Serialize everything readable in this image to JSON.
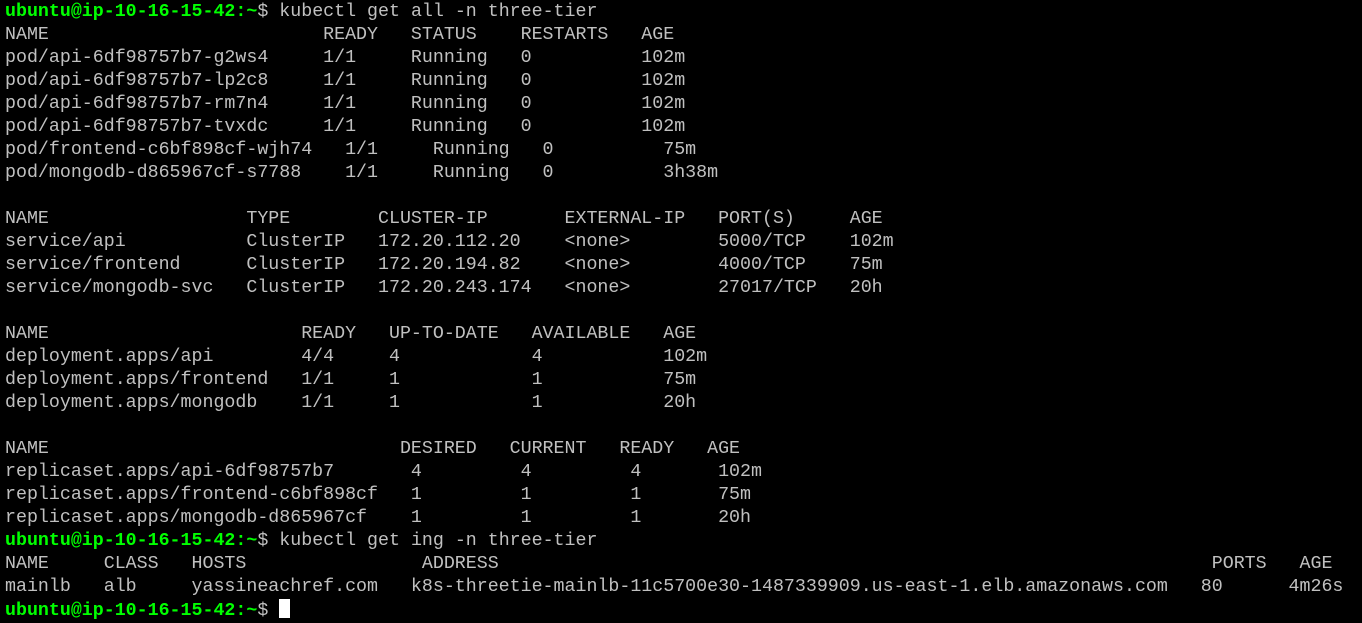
{
  "window": {
    "prompt_user": "ubuntu@ip-10-16-15-42:",
    "prompt_path": "~",
    "prompt_symbol": "$ ",
    "text_color": "#c0c0c0",
    "prompt_color": "#00ff00",
    "background": "#000000"
  },
  "lines": [
    {
      "type": "prompt",
      "command": "kubectl get all -n three-tier"
    },
    {
      "type": "output",
      "text": "NAME                         READY   STATUS    RESTARTS   AGE"
    },
    {
      "type": "output",
      "text": "pod/api-6df98757b7-g2ws4     1/1     Running   0          102m"
    },
    {
      "type": "output",
      "text": "pod/api-6df98757b7-lp2c8     1/1     Running   0          102m"
    },
    {
      "type": "output",
      "text": "pod/api-6df98757b7-rm7n4     1/1     Running   0          102m"
    },
    {
      "type": "output",
      "text": "pod/api-6df98757b7-tvxdc     1/1     Running   0          102m"
    },
    {
      "type": "output",
      "text": "pod/frontend-c6bf898cf-wjh74   1/1     Running   0          75m"
    },
    {
      "type": "output",
      "text": "pod/mongodb-d865967cf-s7788    1/1     Running   0          3h38m"
    },
    {
      "type": "output",
      "text": ""
    },
    {
      "type": "output",
      "text": "NAME                  TYPE        CLUSTER-IP       EXTERNAL-IP   PORT(S)     AGE"
    },
    {
      "type": "output",
      "text": "service/api           ClusterIP   172.20.112.20    <none>        5000/TCP    102m"
    },
    {
      "type": "output",
      "text": "service/frontend      ClusterIP   172.20.194.82    <none>        4000/TCP    75m"
    },
    {
      "type": "output",
      "text": "service/mongodb-svc   ClusterIP   172.20.243.174   <none>        27017/TCP   20h"
    },
    {
      "type": "output",
      "text": ""
    },
    {
      "type": "output",
      "text": "NAME                       READY   UP-TO-DATE   AVAILABLE   AGE"
    },
    {
      "type": "output",
      "text": "deployment.apps/api        4/4     4            4           102m"
    },
    {
      "type": "output",
      "text": "deployment.apps/frontend   1/1     1            1           75m"
    },
    {
      "type": "output",
      "text": "deployment.apps/mongodb    1/1     1            1           20h"
    },
    {
      "type": "output",
      "text": ""
    },
    {
      "type": "output",
      "text": "NAME                                DESIRED   CURRENT   READY   AGE"
    },
    {
      "type": "output",
      "text": "replicaset.apps/api-6df98757b7       4         4         4       102m"
    },
    {
      "type": "output",
      "text": "replicaset.apps/frontend-c6bf898cf   1         1         1       75m"
    },
    {
      "type": "output",
      "text": "replicaset.apps/mongodb-d865967cf    1         1         1       20h"
    },
    {
      "type": "prompt",
      "command": "kubectl get ing -n three-tier"
    },
    {
      "type": "output",
      "text": "NAME     CLASS   HOSTS                ADDRESS                                                                 PORTS   AGE"
    },
    {
      "type": "output",
      "text": "mainlb   alb     yassineachref.com   k8s-threetie-mainlb-11c5700e30-1487339909.us-east-1.elb.amazonaws.com   80      4m26s"
    },
    {
      "type": "prompt",
      "command": "",
      "cursor": true
    }
  ]
}
